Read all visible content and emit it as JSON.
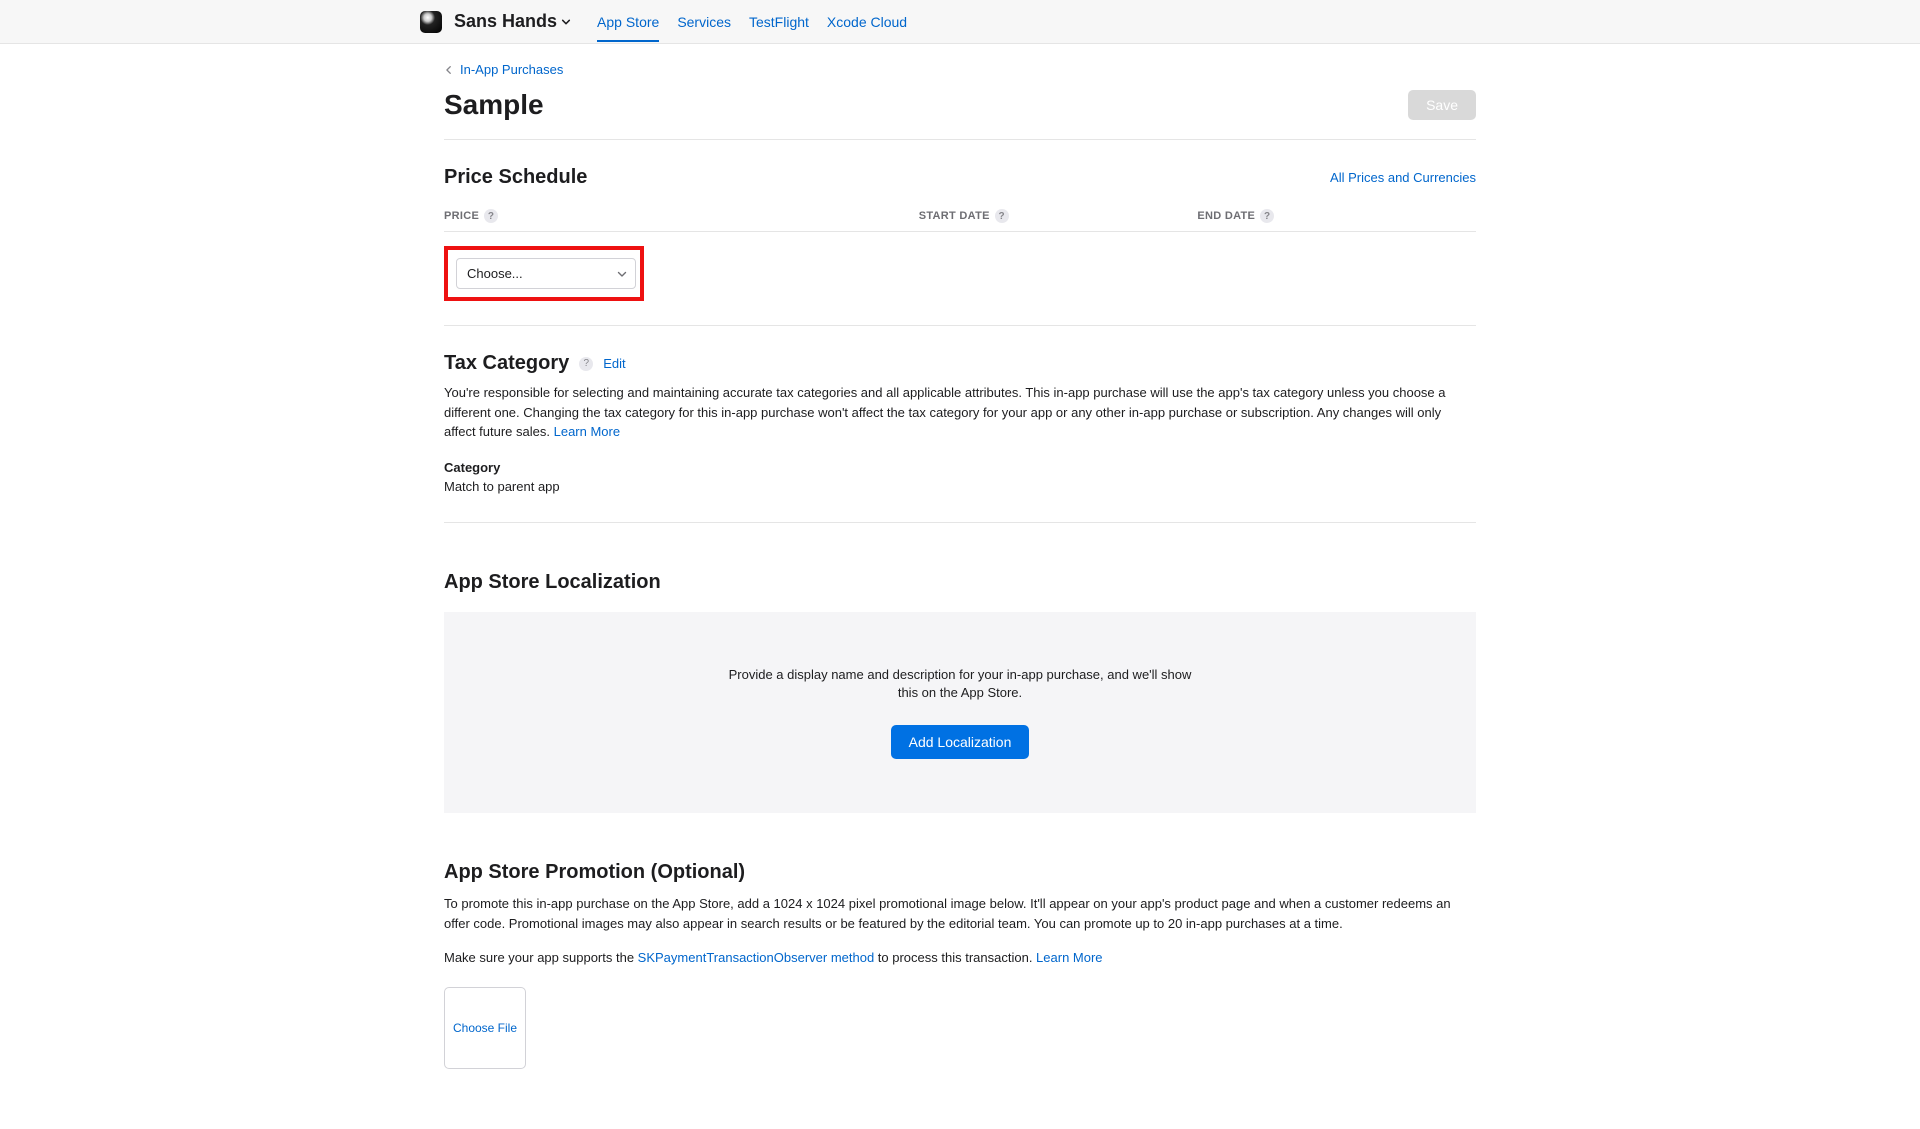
{
  "header": {
    "app_name": "Sans Hands",
    "tabs": [
      "App Store",
      "Services",
      "TestFlight",
      "Xcode Cloud"
    ],
    "active_tab_index": 0
  },
  "breadcrumb": {
    "label": "In-App Purchases"
  },
  "page": {
    "title": "Sample",
    "save_label": "Save"
  },
  "price_schedule": {
    "title": "Price Schedule",
    "all_prices_link": "All Prices and Currencies",
    "columns": {
      "price": "PRICE",
      "start_date": "START DATE",
      "end_date": "END DATE"
    },
    "select_placeholder": "Choose..."
  },
  "tax": {
    "title": "Tax Category",
    "edit_label": "Edit",
    "description": "You're responsible for selecting and maintaining accurate tax categories and all applicable attributes. This in-app purchase will use the app's tax category unless you choose a different one. Changing the tax category for this in-app purchase won't affect the tax category for your app or any other in-app purchase or subscription. Any changes will only affect future sales. ",
    "learn_more": "Learn More",
    "category_label": "Category",
    "category_value": "Match to parent app"
  },
  "localization": {
    "title": "App Store Localization",
    "placeholder_text": "Provide a display name and description for your in-app purchase, and we'll show this on the App Store.",
    "add_button": "Add Localization"
  },
  "promotion": {
    "title": "App Store Promotion (Optional)",
    "description": "To promote this in-app purchase on the App Store, add a 1024 x 1024 pixel promotional image below. It'll appear on your app's product page and when a customer redeems an offer code. Promotional images may also appear in search results or be featured by the editorial team. You can promote up to 20 in-app purchases at a time.",
    "support_prefix": "Make sure your app supports the ",
    "support_link": "SKPaymentTransactionObserver method",
    "support_suffix": " to process this transaction. ",
    "learn_more": "Learn More",
    "choose_file": "Choose File"
  }
}
